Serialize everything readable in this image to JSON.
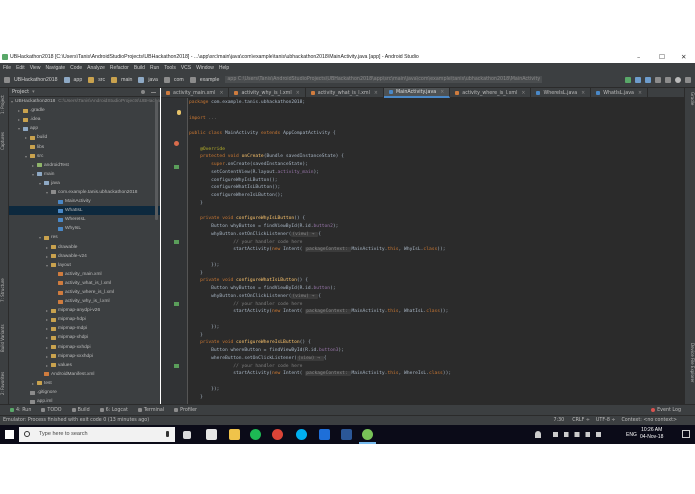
{
  "window": {
    "title": "UBHackathon2018 [C:\\Users\\Tanis\\AndroidStudioProjects\\UBHackathon2018] - ...\\app\\src\\main\\java\\com\\example\\tanis\\ubhackathon2018\\MainActivity.java [app] - Android Studio",
    "minimize": "–",
    "maximize": "☐",
    "close": "✕"
  },
  "menu": [
    "File",
    "Edit",
    "View",
    "Navigate",
    "Code",
    "Analyze",
    "Refactor",
    "Build",
    "Run",
    "Tools",
    "VCS",
    "Window",
    "Help"
  ],
  "breadcrumbs": [
    "UBHackathon2018",
    "app",
    "src",
    "main",
    "java",
    "com",
    "example"
  ],
  "path_tooltip": "app C:\\Users\\Tanis\\AndroidStudioProjects\\UBHackathon2018\\app\\src\\main\\java\\com\\example\\tanis\\ubhackathon2018\\MainActivity",
  "project_panel": {
    "title": "Project",
    "tree": [
      {
        "label": "UBHackathon2018",
        "note": "C:\\Users\\Tanis\\AndroidStudioProjects\\UBHackathon2018",
        "depth": 0,
        "arrow": "▾",
        "color": "#8c8c8c"
      },
      {
        "label": ".gradle",
        "depth": 1,
        "arrow": "▸",
        "color": "#c9a24e"
      },
      {
        "label": ".idea",
        "depth": 1,
        "arrow": "▸",
        "color": "#c9a24e"
      },
      {
        "label": "app",
        "depth": 1,
        "arrow": "▾",
        "color": "#8ea9c5"
      },
      {
        "label": "build",
        "depth": 2,
        "arrow": "▸",
        "color": "#c9a24e"
      },
      {
        "label": "libs",
        "depth": 2,
        "arrow": "",
        "color": "#c9a24e"
      },
      {
        "label": "src",
        "depth": 2,
        "arrow": "▾",
        "color": "#c9a24e"
      },
      {
        "label": "androidTest",
        "depth": 3,
        "arrow": "▸",
        "color": "#8fb56a"
      },
      {
        "label": "main",
        "depth": 3,
        "arrow": "▾",
        "color": "#8ea9c5"
      },
      {
        "label": "java",
        "depth": 4,
        "arrow": "▾",
        "color": "#8ea9c5"
      },
      {
        "label": "com.example.tanis.ubhackathon2018",
        "depth": 5,
        "arrow": "▾",
        "color": "#8c8c8c"
      },
      {
        "label": "MainActivity",
        "depth": 6,
        "arrow": "",
        "color": "#4a88c7"
      },
      {
        "label": "WhatIsL",
        "depth": 6,
        "arrow": "",
        "color": "#4a88c7",
        "selected": true
      },
      {
        "label": "WhereIsL",
        "depth": 6,
        "arrow": "",
        "color": "#4a88c7"
      },
      {
        "label": "WhyIsL",
        "depth": 6,
        "arrow": "",
        "color": "#4a88c7"
      },
      {
        "label": "res",
        "depth": 4,
        "arrow": "▾",
        "color": "#c9a24e"
      },
      {
        "label": "drawable",
        "depth": 5,
        "arrow": "▸",
        "color": "#c9a24e"
      },
      {
        "label": "drawable-v24",
        "depth": 5,
        "arrow": "▸",
        "color": "#c9a24e"
      },
      {
        "label": "layout",
        "depth": 5,
        "arrow": "▾",
        "color": "#c9a24e"
      },
      {
        "label": "activity_main.xml",
        "depth": 6,
        "arrow": "",
        "color": "#d07c3e"
      },
      {
        "label": "activity_what_is_l.xml",
        "depth": 6,
        "arrow": "",
        "color": "#d07c3e"
      },
      {
        "label": "activity_where_is_l.xml",
        "depth": 6,
        "arrow": "",
        "color": "#d07c3e"
      },
      {
        "label": "activity_why_is_l.xml",
        "depth": 6,
        "arrow": "",
        "color": "#d07c3e"
      },
      {
        "label": "mipmap-anydpi-v26",
        "depth": 5,
        "arrow": "▸",
        "color": "#c9a24e"
      },
      {
        "label": "mipmap-hdpi",
        "depth": 5,
        "arrow": "▸",
        "color": "#c9a24e"
      },
      {
        "label": "mipmap-mdpi",
        "depth": 5,
        "arrow": "▸",
        "color": "#c9a24e"
      },
      {
        "label": "mipmap-xhdpi",
        "depth": 5,
        "arrow": "▸",
        "color": "#c9a24e"
      },
      {
        "label": "mipmap-xxhdpi",
        "depth": 5,
        "arrow": "▸",
        "color": "#c9a24e"
      },
      {
        "label": "mipmap-xxxhdpi",
        "depth": 5,
        "arrow": "▸",
        "color": "#c9a24e"
      },
      {
        "label": "values",
        "depth": 5,
        "arrow": "▸",
        "color": "#c9a24e"
      },
      {
        "label": "AndroidManifest.xml",
        "depth": 4,
        "arrow": "",
        "color": "#d07c3e"
      },
      {
        "label": "test",
        "depth": 3,
        "arrow": "▸",
        "color": "#c9a24e"
      },
      {
        "label": ".gitignore",
        "depth": 2,
        "arrow": "",
        "color": "#8c8c8c"
      },
      {
        "label": "app.iml",
        "depth": 2,
        "arrow": "",
        "color": "#8c8c8c"
      }
    ]
  },
  "left_tool_labels": [
    "1: Project",
    "7: Structure",
    "Captures",
    "Build Variants",
    "2: Favorites"
  ],
  "right_tool_labels": [
    "Gradle",
    "Device File Explorer"
  ],
  "editor_tabs": [
    {
      "label": "activity_main.xml",
      "icon": "#d07c3e",
      "active": false
    },
    {
      "label": "activity_why_is_l.xml",
      "icon": "#d07c3e",
      "active": false
    },
    {
      "label": "activity_what_is_l.xml",
      "icon": "#d07c3e",
      "active": false
    },
    {
      "label": "MainActivity.java",
      "icon": "#4a88c7",
      "active": true
    },
    {
      "label": "activity_where_is_l.xml",
      "icon": "#d07c3e",
      "active": false
    },
    {
      "label": "WhereIsL.java",
      "icon": "#4a88c7",
      "active": false
    },
    {
      "label": "WhatIsL.java",
      "icon": "#4a88c7",
      "active": false
    }
  ],
  "code_lines": [
    [
      [
        "kw",
        "package "
      ],
      [
        "",
        "com.example.tanis.ubhackathon2018;"
      ]
    ],
    [],
    [
      [
        "kw",
        "import "
      ],
      [
        "cm",
        "..."
      ]
    ],
    [],
    [
      [
        "kw",
        "public class "
      ],
      [
        "",
        "MainActivity "
      ],
      [
        "kw",
        "extends "
      ],
      [
        "",
        "AppCompatActivity {"
      ]
    ],
    [],
    [
      [
        "an",
        "    @Override"
      ]
    ],
    [
      [
        "kw",
        "    protected void "
      ],
      [
        "fn",
        "onCreate"
      ],
      [
        "",
        "(Bundle savedInstanceState) {"
      ]
    ],
    [
      [
        "kw",
        "        super"
      ],
      [
        "",
        ".onCreate(savedInstanceState);"
      ]
    ],
    [
      [
        "",
        "        setContentView(R.layout."
      ],
      [
        "pp",
        "activity_main"
      ],
      [
        "",
        ");"
      ]
    ],
    [
      [
        "",
        "        configureWhyIsLButton();"
      ]
    ],
    [
      [
        "",
        "        configureWhatIsLButton();"
      ]
    ],
    [
      [
        "",
        "        configureWhereIsLButton();"
      ]
    ],
    [
      [
        "",
        "    }"
      ]
    ],
    [],
    [
      [
        "kw",
        "    private void "
      ],
      [
        "fn",
        "configureWhyIsLButton"
      ],
      [
        "",
        "() {"
      ]
    ],
    [
      [
        "",
        "        Button whyButton = findViewById(R.id."
      ],
      [
        "pp",
        "button2"
      ],
      [
        "",
        ");"
      ]
    ],
    [
      [
        "",
        "        whyButton.setOnClickListener("
      ],
      [
        "hint",
        "(view) → "
      ],
      [
        "",
        "{"
      ]
    ],
    [
      [
        "cm",
        "                // your handler code here"
      ]
    ],
    [
      [
        "",
        "                startActivity("
      ],
      [
        "kw",
        "new "
      ],
      [
        "",
        "Intent( "
      ],
      [
        "hint",
        "packageContext: "
      ],
      [
        "",
        "MainActivity."
      ],
      [
        "kw",
        "this"
      ],
      [
        "",
        ", WhyIsL."
      ],
      [
        "kw",
        "class"
      ],
      [
        "",
        "));"
      ]
    ],
    [],
    [
      [
        "",
        "        });"
      ]
    ],
    [
      [
        "",
        "    }"
      ]
    ],
    [
      [
        "kw",
        "    private void "
      ],
      [
        "fn",
        "configureWhatIsLButton"
      ],
      [
        "",
        "() {"
      ]
    ],
    [
      [
        "",
        "        Button whyButton = findViewById(R.id."
      ],
      [
        "pp",
        "button"
      ],
      [
        "",
        ");"
      ]
    ],
    [
      [
        "",
        "        whyButton.setOnClickListener("
      ],
      [
        "hint",
        "(view) → "
      ],
      [
        "",
        "{"
      ]
    ],
    [
      [
        "cm",
        "                // your handler code here"
      ]
    ],
    [
      [
        "",
        "                startActivity("
      ],
      [
        "kw",
        "new "
      ],
      [
        "",
        "Intent( "
      ],
      [
        "hint",
        "packageContext: "
      ],
      [
        "",
        "MainActivity."
      ],
      [
        "kw",
        "this"
      ],
      [
        "",
        ", WhatIsL."
      ],
      [
        "kw",
        "class"
      ],
      [
        "",
        "));"
      ]
    ],
    [],
    [
      [
        "",
        "        });"
      ]
    ],
    [
      [
        "",
        "    }"
      ]
    ],
    [
      [
        "kw",
        "    private void "
      ],
      [
        "fn",
        "configureWhereIsLButton"
      ],
      [
        "",
        "() {"
      ]
    ],
    [
      [
        "",
        "        Button whereButton = findViewById(R.id."
      ],
      [
        "pp",
        "button3"
      ],
      [
        "",
        ");"
      ]
    ],
    [
      [
        "",
        "        whereButton.setOnClickListener("
      ],
      [
        "hint",
        "(view) → "
      ],
      [
        "",
        "{"
      ]
    ],
    [
      [
        "cm",
        "                // your handler code here"
      ]
    ],
    [
      [
        "",
        "                startActivity("
      ],
      [
        "kw",
        "new "
      ],
      [
        "",
        "Intent( "
      ],
      [
        "hint",
        "packageContext: "
      ],
      [
        "",
        "MainActivity."
      ],
      [
        "kw",
        "this"
      ],
      [
        "",
        ", WhereIsL."
      ],
      [
        "kw",
        "class"
      ],
      [
        "",
        "));"
      ]
    ],
    [],
    [
      [
        "",
        "        });"
      ]
    ],
    [
      [
        "",
        "    }"
      ]
    ]
  ],
  "bottom_tools": [
    {
      "label": "4: Run",
      "icon": "#59a869"
    },
    {
      "label": "TODO",
      "icon": "#8c8c8c"
    },
    {
      "label": "Build",
      "icon": "#8c8c8c"
    },
    {
      "label": "6: Logcat",
      "icon": "#8c8c8c"
    },
    {
      "label": "Terminal",
      "icon": "#8c8c8c"
    },
    {
      "label": "Profiler",
      "icon": "#8c8c8c"
    }
  ],
  "event_log": "Event Log",
  "status": {
    "message": "Emulator: Process finished with exit code 0 (13 minutes ago)",
    "position": "7:30",
    "line_sep": "CRLF ÷",
    "encoding": "UTF-8 ÷",
    "context": "Context: <no context>"
  },
  "taskbar": {
    "search_placeholder": "Type here to search",
    "lang": "ENG",
    "time": "10:26 AM",
    "date": "04-Nov-18"
  },
  "colors": {
    "accent": "#4a88c7",
    "editor_bg": "#2b2b2b",
    "panel_bg": "#3c3f41"
  }
}
